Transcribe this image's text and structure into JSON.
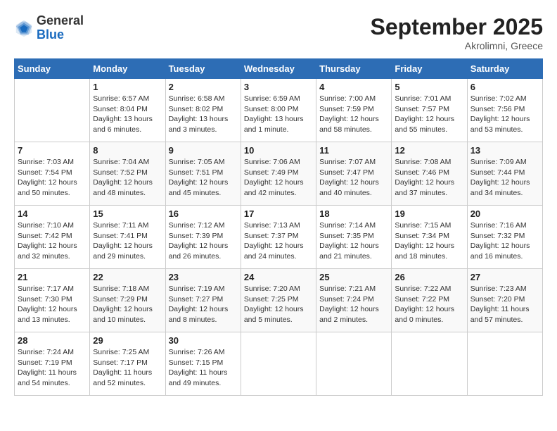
{
  "header": {
    "logo_general": "General",
    "logo_blue": "Blue",
    "month_title": "September 2025",
    "location": "Akrolimni, Greece"
  },
  "days_of_week": [
    "Sunday",
    "Monday",
    "Tuesday",
    "Wednesday",
    "Thursday",
    "Friday",
    "Saturday"
  ],
  "weeks": [
    [
      {
        "day": "",
        "info": ""
      },
      {
        "day": "1",
        "info": "Sunrise: 6:57 AM\nSunset: 8:04 PM\nDaylight: 13 hours\nand 6 minutes."
      },
      {
        "day": "2",
        "info": "Sunrise: 6:58 AM\nSunset: 8:02 PM\nDaylight: 13 hours\nand 3 minutes."
      },
      {
        "day": "3",
        "info": "Sunrise: 6:59 AM\nSunset: 8:00 PM\nDaylight: 13 hours\nand 1 minute."
      },
      {
        "day": "4",
        "info": "Sunrise: 7:00 AM\nSunset: 7:59 PM\nDaylight: 12 hours\nand 58 minutes."
      },
      {
        "day": "5",
        "info": "Sunrise: 7:01 AM\nSunset: 7:57 PM\nDaylight: 12 hours\nand 55 minutes."
      },
      {
        "day": "6",
        "info": "Sunrise: 7:02 AM\nSunset: 7:56 PM\nDaylight: 12 hours\nand 53 minutes."
      }
    ],
    [
      {
        "day": "7",
        "info": "Sunrise: 7:03 AM\nSunset: 7:54 PM\nDaylight: 12 hours\nand 50 minutes."
      },
      {
        "day": "8",
        "info": "Sunrise: 7:04 AM\nSunset: 7:52 PM\nDaylight: 12 hours\nand 48 minutes."
      },
      {
        "day": "9",
        "info": "Sunrise: 7:05 AM\nSunset: 7:51 PM\nDaylight: 12 hours\nand 45 minutes."
      },
      {
        "day": "10",
        "info": "Sunrise: 7:06 AM\nSunset: 7:49 PM\nDaylight: 12 hours\nand 42 minutes."
      },
      {
        "day": "11",
        "info": "Sunrise: 7:07 AM\nSunset: 7:47 PM\nDaylight: 12 hours\nand 40 minutes."
      },
      {
        "day": "12",
        "info": "Sunrise: 7:08 AM\nSunset: 7:46 PM\nDaylight: 12 hours\nand 37 minutes."
      },
      {
        "day": "13",
        "info": "Sunrise: 7:09 AM\nSunset: 7:44 PM\nDaylight: 12 hours\nand 34 minutes."
      }
    ],
    [
      {
        "day": "14",
        "info": "Sunrise: 7:10 AM\nSunset: 7:42 PM\nDaylight: 12 hours\nand 32 minutes."
      },
      {
        "day": "15",
        "info": "Sunrise: 7:11 AM\nSunset: 7:41 PM\nDaylight: 12 hours\nand 29 minutes."
      },
      {
        "day": "16",
        "info": "Sunrise: 7:12 AM\nSunset: 7:39 PM\nDaylight: 12 hours\nand 26 minutes."
      },
      {
        "day": "17",
        "info": "Sunrise: 7:13 AM\nSunset: 7:37 PM\nDaylight: 12 hours\nand 24 minutes."
      },
      {
        "day": "18",
        "info": "Sunrise: 7:14 AM\nSunset: 7:35 PM\nDaylight: 12 hours\nand 21 minutes."
      },
      {
        "day": "19",
        "info": "Sunrise: 7:15 AM\nSunset: 7:34 PM\nDaylight: 12 hours\nand 18 minutes."
      },
      {
        "day": "20",
        "info": "Sunrise: 7:16 AM\nSunset: 7:32 PM\nDaylight: 12 hours\nand 16 minutes."
      }
    ],
    [
      {
        "day": "21",
        "info": "Sunrise: 7:17 AM\nSunset: 7:30 PM\nDaylight: 12 hours\nand 13 minutes."
      },
      {
        "day": "22",
        "info": "Sunrise: 7:18 AM\nSunset: 7:29 PM\nDaylight: 12 hours\nand 10 minutes."
      },
      {
        "day": "23",
        "info": "Sunrise: 7:19 AM\nSunset: 7:27 PM\nDaylight: 12 hours\nand 8 minutes."
      },
      {
        "day": "24",
        "info": "Sunrise: 7:20 AM\nSunset: 7:25 PM\nDaylight: 12 hours\nand 5 minutes."
      },
      {
        "day": "25",
        "info": "Sunrise: 7:21 AM\nSunset: 7:24 PM\nDaylight: 12 hours\nand 2 minutes."
      },
      {
        "day": "26",
        "info": "Sunrise: 7:22 AM\nSunset: 7:22 PM\nDaylight: 12 hours\nand 0 minutes."
      },
      {
        "day": "27",
        "info": "Sunrise: 7:23 AM\nSunset: 7:20 PM\nDaylight: 11 hours\nand 57 minutes."
      }
    ],
    [
      {
        "day": "28",
        "info": "Sunrise: 7:24 AM\nSunset: 7:19 PM\nDaylight: 11 hours\nand 54 minutes."
      },
      {
        "day": "29",
        "info": "Sunrise: 7:25 AM\nSunset: 7:17 PM\nDaylight: 11 hours\nand 52 minutes."
      },
      {
        "day": "30",
        "info": "Sunrise: 7:26 AM\nSunset: 7:15 PM\nDaylight: 11 hours\nand 49 minutes."
      },
      {
        "day": "",
        "info": ""
      },
      {
        "day": "",
        "info": ""
      },
      {
        "day": "",
        "info": ""
      },
      {
        "day": "",
        "info": ""
      }
    ]
  ]
}
